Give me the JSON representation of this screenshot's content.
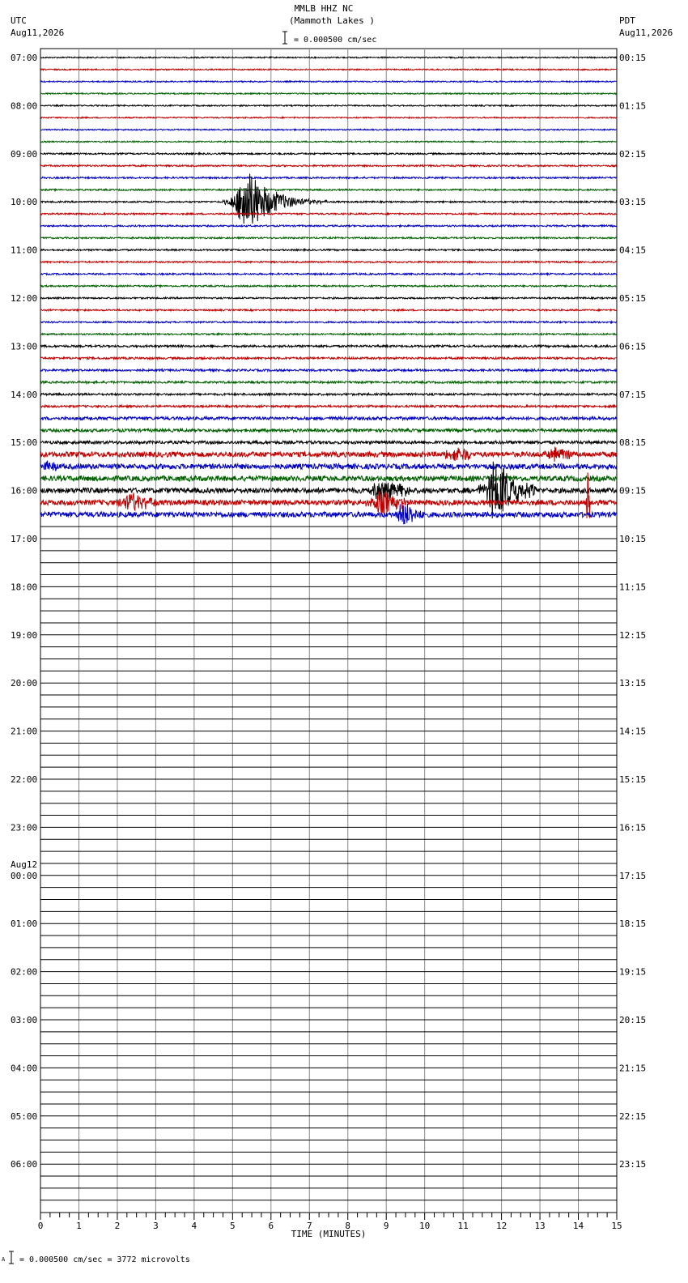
{
  "header": {
    "station": "MMLB HHZ NC",
    "location": "(Mammoth Lakes )",
    "scale_label": "= 0.000500 cm/sec",
    "left_tz": "UTC",
    "left_date": "Aug11,2026",
    "right_tz": "PDT",
    "right_date": "Aug11,2026"
  },
  "footer": {
    "scale_note": "= 0.000500 cm/sec =    3772 microvolts",
    "scale_prefix": "A"
  },
  "chart_data": {
    "type": "line",
    "title": "MMLB HHZ NC",
    "subtitle": "(Mammoth Lakes )",
    "xlabel": "TIME (MINUTES)",
    "xlim": [
      0,
      15
    ],
    "x_ticks": [
      "0",
      "1",
      "2",
      "3",
      "4",
      "5",
      "6",
      "7",
      "8",
      "9",
      "10",
      "11",
      "12",
      "13",
      "14",
      "15"
    ],
    "left_axis_labels": [
      "07:00",
      "08:00",
      "09:00",
      "10:00",
      "11:00",
      "12:00",
      "13:00",
      "14:00",
      "15:00",
      "16:00",
      "17:00",
      "18:00",
      "19:00",
      "20:00",
      "21:00",
      "22:00",
      "23:00",
      "00:00",
      "01:00",
      "02:00",
      "03:00",
      "04:00",
      "05:00",
      "06:00"
    ],
    "left_date_change": {
      "hour_index": 17,
      "label": "Aug12"
    },
    "right_axis_labels": [
      "00:15",
      "01:15",
      "02:15",
      "03:15",
      "04:15",
      "05:15",
      "06:15",
      "07:15",
      "08:15",
      "09:15",
      "10:15",
      "11:15",
      "12:15",
      "13:15",
      "14:15",
      "15:15",
      "16:15",
      "17:15",
      "18:15",
      "19:15",
      "20:15",
      "21:15",
      "22:15",
      "23:15"
    ],
    "rows_per_hour": 4,
    "total_rows": 96,
    "recorded_rows": 39,
    "trace_colors": [
      "#000000",
      "#c00000",
      "#0000c0",
      "#006000"
    ],
    "grid": true,
    "events": [
      {
        "row": 12,
        "start_min": 4.75,
        "end_min": 7.5,
        "peak_min": 5.3,
        "amplitude": 1.0
      },
      {
        "row": 33,
        "start_min": 10.5,
        "end_min": 11.2,
        "peak_min": 10.8,
        "amplitude": 0.25
      },
      {
        "row": 33,
        "start_min": 13.0,
        "end_min": 13.8,
        "peak_min": 13.4,
        "amplitude": 0.2
      },
      {
        "row": 34,
        "start_min": 0.0,
        "end_min": 0.4,
        "peak_min": 0.2,
        "amplitude": 0.15
      },
      {
        "row": 36,
        "start_min": 8.5,
        "end_min": 9.6,
        "peak_min": 8.8,
        "amplitude": 0.35
      },
      {
        "row": 36,
        "start_min": 10.8,
        "end_min": 12.9,
        "peak_min": 11.8,
        "amplitude": 0.9
      },
      {
        "row": 37,
        "start_min": 2.0,
        "end_min": 3.0,
        "peak_min": 2.3,
        "amplitude": 0.3
      },
      {
        "row": 37,
        "start_min": 8.2,
        "end_min": 9.5,
        "peak_min": 8.8,
        "amplitude": 0.35
      },
      {
        "row": 37,
        "start_min": 14.2,
        "end_min": 14.3,
        "peak_min": 14.25,
        "amplitude": 1.0
      },
      {
        "row": 38,
        "start_min": 9.2,
        "end_min": 10.0,
        "peak_min": 9.4,
        "amplitude": 0.35
      }
    ]
  }
}
